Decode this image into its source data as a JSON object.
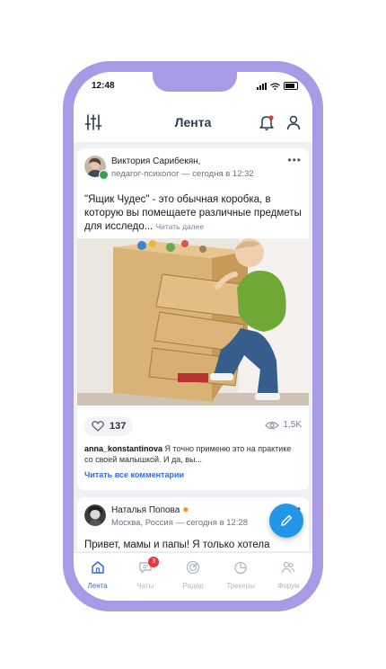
{
  "status": {
    "time": "12:48"
  },
  "header": {
    "title": "Лента"
  },
  "post1": {
    "author": "Виктория Сарибекян,",
    "subtitle": "педагог-психолог — сегодня в 12:32",
    "text": "\"Ящик Чудес\" - это обычная коробка, в которую вы помещаете различные предметы для исследо...",
    "read_more": "Читать далее",
    "likes": "137",
    "views": "1,5K",
    "comment_user": "anna_konstantinova",
    "comment_text": "Я точно применю это на практике со своей малышкой. И да, вы...",
    "all_comments": "Читать все комментарии"
  },
  "post2": {
    "author": "Наталья Попова",
    "subtitle": "Москва, Россия — сегодня в 12:28",
    "text": "Привет, мамы и папы! Я только хотела"
  },
  "tabs": [
    {
      "label": "Лента"
    },
    {
      "label": "Чаты",
      "badge": "3"
    },
    {
      "label": "Радар"
    },
    {
      "label": "Трекеры"
    },
    {
      "label": "Форум"
    }
  ],
  "colors": {
    "accent": "#2f6fd6",
    "frame": "#a99ae6",
    "badge": "#e5393e",
    "fab": "#2196e8"
  }
}
